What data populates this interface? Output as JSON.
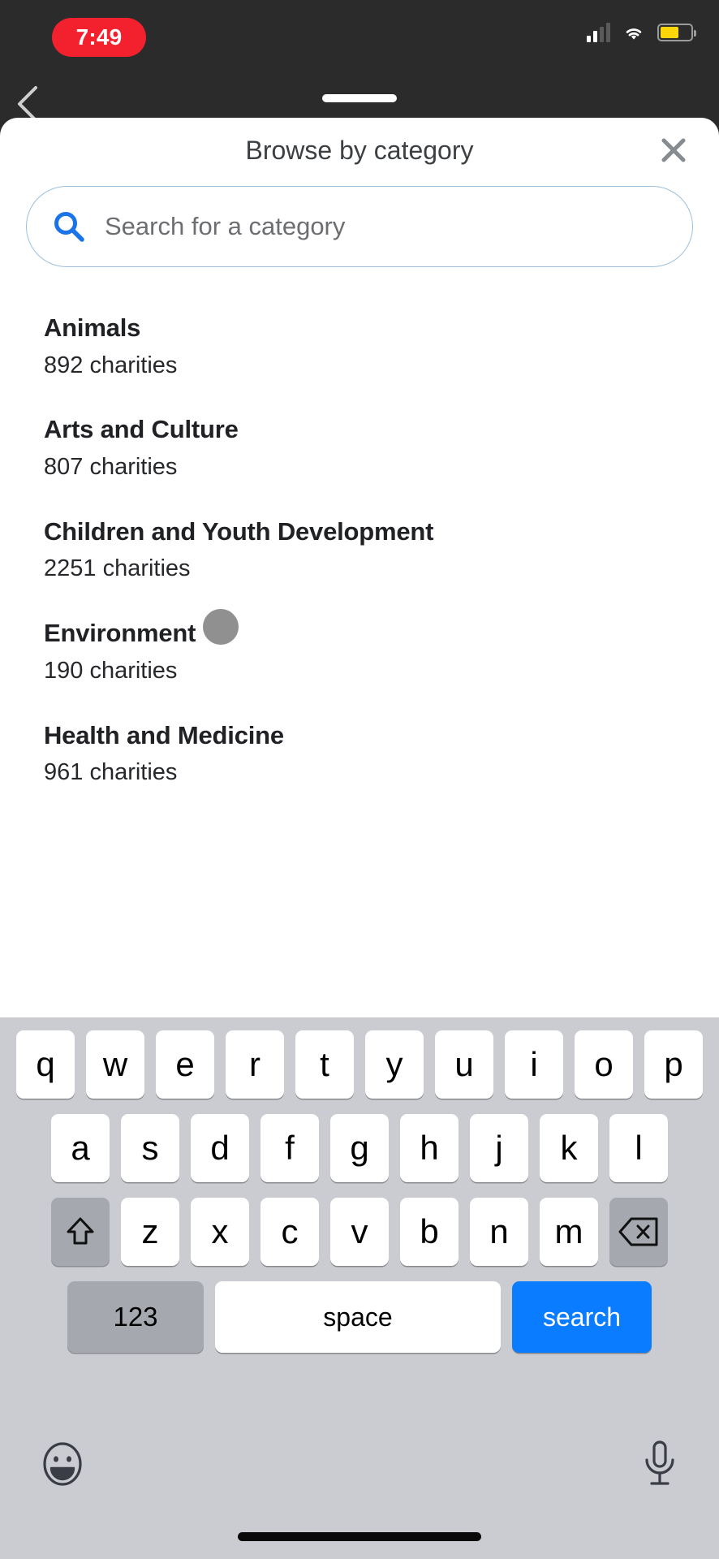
{
  "status_bar": {
    "time": "7:49",
    "recording_pill_color": "#f3212e",
    "battery_color": "#ffd60a",
    "icons": [
      "cellular-signal-icon",
      "wifi-icon",
      "battery-icon"
    ]
  },
  "sheet": {
    "title": "Browse by category",
    "close_label": "✕"
  },
  "search": {
    "placeholder": "Search for a category",
    "value": "",
    "icon_color": "#1a73e8"
  },
  "categories": [
    {
      "name": "Animals",
      "count": "892 charities"
    },
    {
      "name": "Arts and Culture",
      "count": "807 charities"
    },
    {
      "name": "Children and Youth Development",
      "count": "2251 charities"
    },
    {
      "name": "Environment",
      "count": "190 charities"
    },
    {
      "name": "Health and Medicine",
      "count": "961 charities"
    }
  ],
  "keyboard": {
    "row1": [
      "q",
      "w",
      "e",
      "r",
      "t",
      "y",
      "u",
      "i",
      "o",
      "p"
    ],
    "row2": [
      "a",
      "s",
      "d",
      "f",
      "g",
      "h",
      "j",
      "k",
      "l"
    ],
    "row3": [
      "z",
      "x",
      "c",
      "v",
      "b",
      "n",
      "m"
    ],
    "shift_label": "⇧",
    "backspace_label": "⌫",
    "numbers_label": "123",
    "space_label": "space",
    "return_label": "search",
    "return_color": "#0a7cff",
    "emoji_icon": "emoji-smiley-icon",
    "mic_icon": "microphone-icon"
  }
}
